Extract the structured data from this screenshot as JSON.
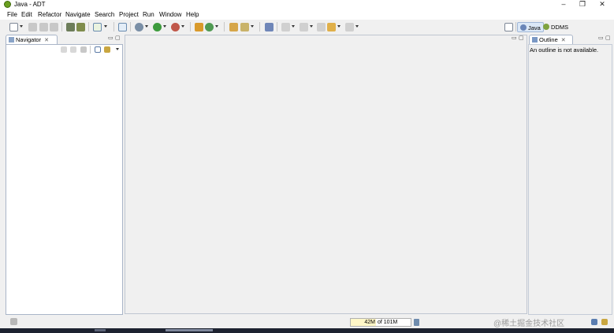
{
  "window": {
    "title": "Java - ADT",
    "controls": {
      "minimize": "–",
      "maximize": "❐",
      "close": "✕"
    }
  },
  "menu": [
    "File",
    "Edit",
    "Refactor",
    "Navigate",
    "Search",
    "Project",
    "Run",
    "Window",
    "Help"
  ],
  "perspectives": [
    {
      "label": "Java",
      "active": true,
      "icon": "java-perspective-icon"
    },
    {
      "label": "DDMS",
      "active": false,
      "icon": "ddms-perspective-icon"
    }
  ],
  "navigator": {
    "tab_label": "Navigator",
    "close": "✕",
    "minimize": "▭",
    "maximize": "▢"
  },
  "outline": {
    "tab_label": "Outline",
    "close": "✕",
    "message": "An outline is not available.",
    "minimize": "▭",
    "maximize": "▢"
  },
  "status": {
    "heap_used": "42M",
    "heap_total": "of 101M",
    "heap_fraction": 0.42
  },
  "watermark": "@稀土掘金技术社区",
  "colors": {
    "pane_border": "#a9b5c8",
    "background": "#f0f0f0",
    "active_perspective": "#dbe8f7"
  }
}
